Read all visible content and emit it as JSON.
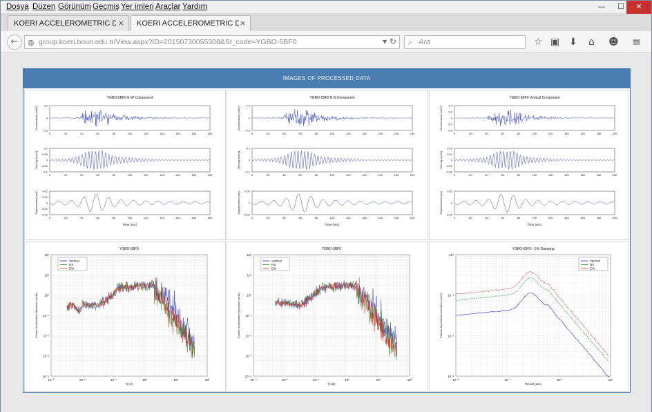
{
  "menu": [
    "Dosya",
    "Düzen",
    "Görünüm",
    "Geçmiş",
    "Yer imleri",
    "Araçlar",
    "Yardım"
  ],
  "window_controls": {
    "minimize": "—",
    "maximize": "☐",
    "close": "✕"
  },
  "tabs": [
    {
      "label": "KOERI ACCELEROMETRIC DAT...",
      "close": "×"
    },
    {
      "label": "KOERI ACCELEROMETRIC DAT...",
      "close": "×"
    }
  ],
  "new_tab": "+",
  "address_bar": {
    "url": "group.koeri.boun.edu.tr/View.aspx?ID=20150730055308&St_code=YGBO-5BF0"
  },
  "search": {
    "placeholder": "Ara"
  },
  "panel": {
    "title": "IMAGES OF PROCESSED DATA"
  },
  "time_plots": [
    {
      "title": "YGBO-5BF0 E-W Component",
      "rows": [
        {
          "ylabel": "Acceleration (cm/s²)",
          "yticks": [
            "0.2",
            "0",
            "-0.2"
          ]
        },
        {
          "ylabel": "Velocity (cm/s)",
          "yticks": [
            "0.1",
            "0.05",
            "0",
            "-0.05",
            "-0.1"
          ]
        },
        {
          "ylabel": "Displacement (cm)",
          "yticks": [
            "0.02",
            "0.01",
            "0",
            "-0.01",
            "-0.02"
          ]
        }
      ],
      "xticks": [
        "0",
        "20",
        "40",
        "60",
        "80",
        "100",
        "120",
        "140",
        "160",
        "180",
        "200"
      ],
      "xlabel": "Time (sec)"
    },
    {
      "title": "YGBO-5BF0 N-S Component",
      "rows": [
        {
          "ylabel": "Acceleration (cm/s²)",
          "yticks": [
            "0.2",
            "0",
            "-0.2"
          ]
        },
        {
          "ylabel": "Velocity (cm/s)",
          "yticks": [
            "0.1",
            "0",
            "-0.1"
          ]
        },
        {
          "ylabel": "Displacement (cm)",
          "yticks": [
            "0.02",
            "0",
            "-0.02"
          ]
        }
      ],
      "xticks": [
        "0",
        "20",
        "40",
        "60",
        "80",
        "100",
        "120",
        "140",
        "160",
        "180",
        "200"
      ],
      "xlabel": "Time (sec)"
    },
    {
      "title": "YGBO-5BF0 Vertical Component",
      "rows": [
        {
          "ylabel": "Acceleration (cm/s²)",
          "yticks": [
            "0.4",
            "0.2",
            "0",
            "-0.2",
            "-0.4"
          ]
        },
        {
          "ylabel": "Velocity (cm/s)",
          "yticks": [
            "0.02",
            "0.01",
            "0",
            "-0.01",
            "-0.02"
          ]
        },
        {
          "ylabel": "Displacement (cm)",
          "yticks": [
            "0.02",
            "0",
            "-0.02"
          ]
        }
      ],
      "xticks": [
        "0",
        "20",
        "40",
        "60",
        "80",
        "100",
        "120",
        "140",
        "160",
        "180",
        "200"
      ],
      "xlabel": "Time (sec)"
    }
  ],
  "spectrum_plots": [
    {
      "title": "YGBO-5BF0",
      "ylabel": "Fourier Acceleration Spectrum (cm/s)",
      "xlabel": "f (Hz)",
      "yticks": [
        "10²",
        "10¹",
        "10⁰",
        "10⁻¹",
        "10⁻²",
        "10⁻³",
        "10⁻⁴"
      ],
      "xticks": [
        "10⁻³",
        "10⁻²",
        "10⁻¹",
        "10⁰",
        "10¹",
        "10²"
      ],
      "legend": [
        "Vertical",
        "NS",
        "EW"
      ]
    },
    {
      "title": "YGBO-5BF0",
      "ylabel": "Fourier Acceleration Spectrum (cm/s)",
      "xlabel": "f (Hz)",
      "yticks": [
        "10²",
        "10¹",
        "10⁰",
        "10⁻¹",
        "10⁻²",
        "10⁻³",
        "10⁻⁴"
      ],
      "xticks": [
        "10⁻³",
        "10⁻²",
        "10⁻¹",
        "10⁰",
        "10¹",
        "10²"
      ],
      "legend": [
        "Vertical",
        "NS",
        "EW"
      ]
    },
    {
      "title": "YGBO-5BF0 - 5% Damping",
      "ylabel": "Pseudo Spectral Acceleration (cm/s²)",
      "xlabel": "Period (sec)",
      "yticks": [
        "10⁰",
        "10⁻¹",
        "10⁻²",
        "10⁻³"
      ],
      "xticks": [
        "10⁻²",
        "10⁻¹",
        "10⁰",
        "10¹"
      ],
      "legend": [
        "Vertical",
        "NS",
        "EW"
      ]
    }
  ],
  "colors": {
    "vertical": "#1f2fd0",
    "ns": "#1f8c1f",
    "ew": "#e02020",
    "trace": "#2233bb",
    "header": "#4a7eb2"
  }
}
